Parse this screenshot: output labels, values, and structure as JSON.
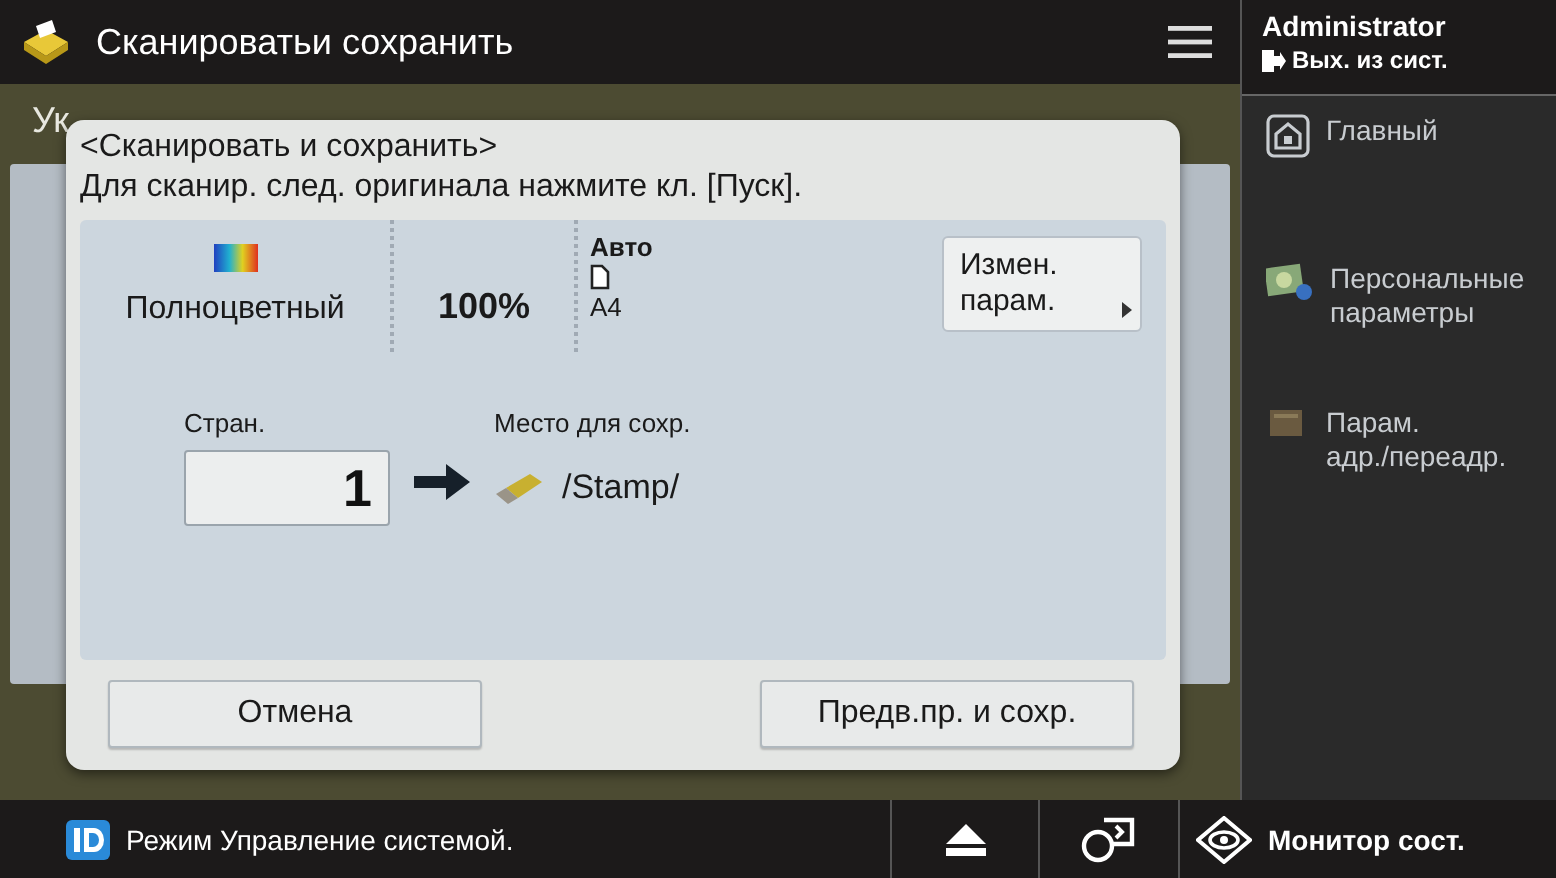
{
  "header": {
    "title": "Сканироватьи сохранить"
  },
  "background_hint": "Ук",
  "dialog": {
    "title": "<Сканировать и сохранить>",
    "message": "Для сканир. след. оригинала нажмите кл. [Пуск].",
    "settings": {
      "color_mode": "Полноцветный",
      "zoom": "100%",
      "size_mode": "Авто",
      "paper_size": "A4",
      "change_button": "Измен.\nпарам."
    },
    "pages": {
      "label": "Стран.",
      "value": "1"
    },
    "destination": {
      "label": "Место для сохр.",
      "path": "/Stamp/"
    },
    "buttons": [
      {
        "label": "Отмена"
      },
      {
        "label": "Предв.пр. и сохр."
      }
    ]
  },
  "user": {
    "name": "Administrator",
    "logout": "Вых. из сист."
  },
  "side_menu": [
    {
      "label": "Главный",
      "kind": "home"
    },
    {
      "label": "Персональные\nпараметры",
      "kind": "personal"
    },
    {
      "label": "Парам.\nадр./переадр.",
      "kind": "address"
    }
  ],
  "status_bar": {
    "mode": "Режим Управление системой.",
    "monitor": "Монитор сост."
  }
}
